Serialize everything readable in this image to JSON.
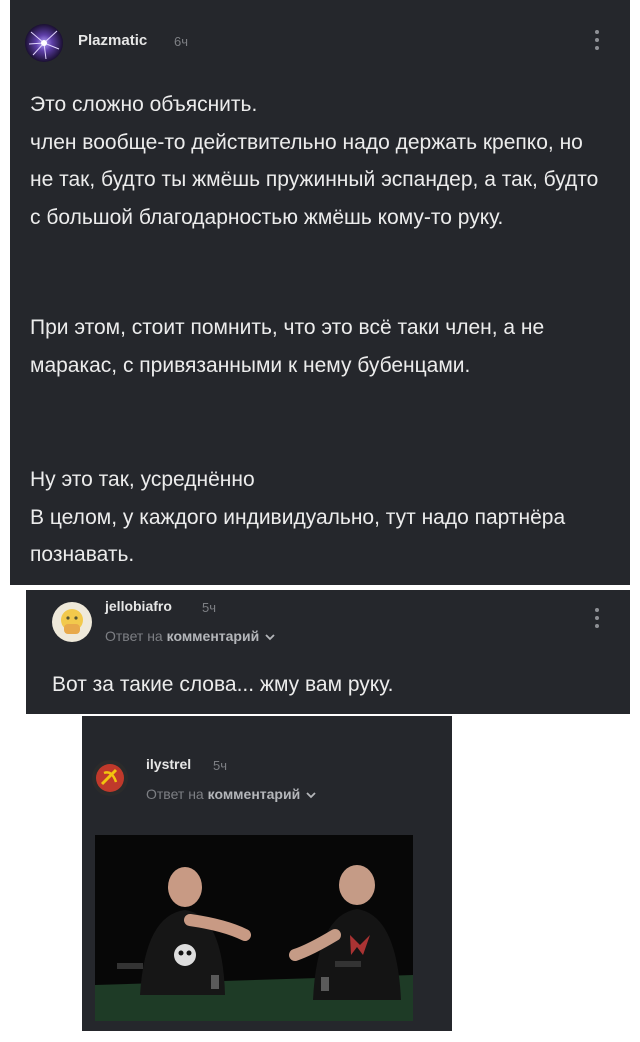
{
  "comments": [
    {
      "username": "Plazmatic",
      "time": "6ч",
      "paragraphs": [
        "Это сложно объяснить.\nчлен вообще-то действительно надо держать крепко, но не так, будто ты жмёшь пружинный эспандер, а так, будто с большой благодарностью жмёшь кому-то руку.",
        "При этом, стоит помнить, что это всё таки член, а не маракас, с привязанными к нему бубенцами.",
        "Ну это так, усреднённо\nВ целом, у каждого индивидуально, тут надо партнёра познавать."
      ]
    },
    {
      "username": "jellobiafro",
      "time": "5ч",
      "reply_prefix": "Ответ на",
      "reply_target": "комментарий",
      "text": "Вот за такие слова... жму вам руку."
    },
    {
      "username": "ilystrel",
      "time": "5ч",
      "reply_prefix": "Ответ на",
      "reply_target": "комментарий",
      "media": "two-men-shaking-hands-video-frame"
    }
  ],
  "icons": [
    "more-vertical-icon",
    "chevron-down-icon"
  ],
  "colors": {
    "card_bg": "#25272c",
    "text": "#ececec",
    "muted": "#7d7f84",
    "page_bg": "#ffffff"
  }
}
